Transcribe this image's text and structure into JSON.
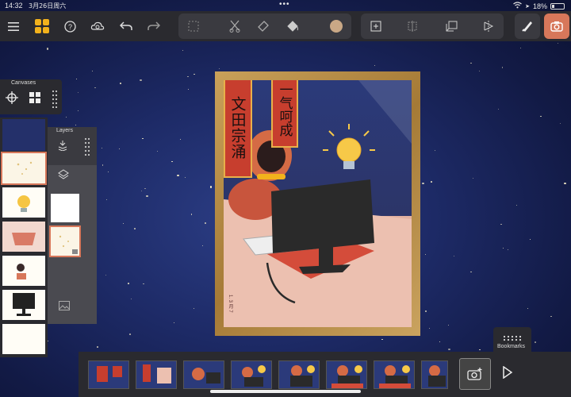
{
  "status": {
    "time": "14:32",
    "date": "3月26日周六",
    "battery": "18%"
  },
  "toolbar": {
    "icons": [
      "menu-icon",
      "gallery-icon",
      "help-icon",
      "cloud-icon",
      "undo-icon",
      "redo-icon"
    ],
    "tools": [
      "selection-icon",
      "cut-icon",
      "eraser-icon",
      "fill-icon"
    ],
    "current_color": "#c9a886",
    "canvas_tools": [
      "add-canvas-icon",
      "split-icon",
      "copy-icon",
      "flip-icon"
    ],
    "accent": "#d7775a"
  },
  "canvases": {
    "title": "Canvases",
    "thumbnail_count": 7,
    "selected_index": 1
  },
  "layers": {
    "title": "Layers",
    "thumbnail_count": 2,
    "selected_index": 1
  },
  "artwork": {
    "banner_left": "文田宗涌",
    "banner_top": "一气呵成",
    "signature": "1. 3 月 7"
  },
  "filmstrip": {
    "frame_count": 8
  },
  "bookmarks": {
    "label": "Bookmarks"
  }
}
